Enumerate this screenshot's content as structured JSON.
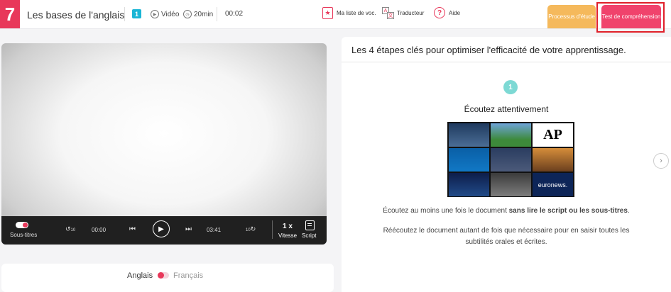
{
  "header": {
    "logo": "7",
    "course_title": "Les bases de l'anglais",
    "lesson_number": "1",
    "media_type": "Vidéo",
    "duration": "20min",
    "timer": "00:02",
    "tools": {
      "vocab": "Ma liste de voc.",
      "translator": "Traducteur",
      "help": "Aide"
    },
    "tabs": {
      "process": "Processus d'étude",
      "test": "Test de compréhension"
    }
  },
  "player": {
    "subtitles_label": "Sous-titres",
    "current_time": "00:00",
    "total_time": "03:41",
    "speed_value": "1 x",
    "speed_label": "Vitesse",
    "script_label": "Script",
    "rewind_label": "10",
    "forward_label": "10"
  },
  "language": {
    "active": "Anglais",
    "inactive": "Français"
  },
  "panel": {
    "title": "Les 4 étapes clés pour optimiser l'efficacité de votre apprentissage.",
    "step_number": "1",
    "step_title": "Écoutez attentivement",
    "para1_prefix": "Écoutez au moins une fois le document ",
    "para1_bold": "sans lire le script ou les sous-titres",
    "para1_suffix": ".",
    "para2": "Réécoutez le document autant de fois que nécessaire pour en saisir toutes les subtilités orales et écrites.",
    "mosaic_ap": "AP",
    "mosaic_euronews": "euronews."
  },
  "colors": {
    "brand": "#e8385a",
    "process_tab": "#f5b95c",
    "test_tab": "#f0436c",
    "lesson_badge": "#1ab5d5",
    "step_badge": "#7dd9d4",
    "highlight": "#e0202a"
  }
}
